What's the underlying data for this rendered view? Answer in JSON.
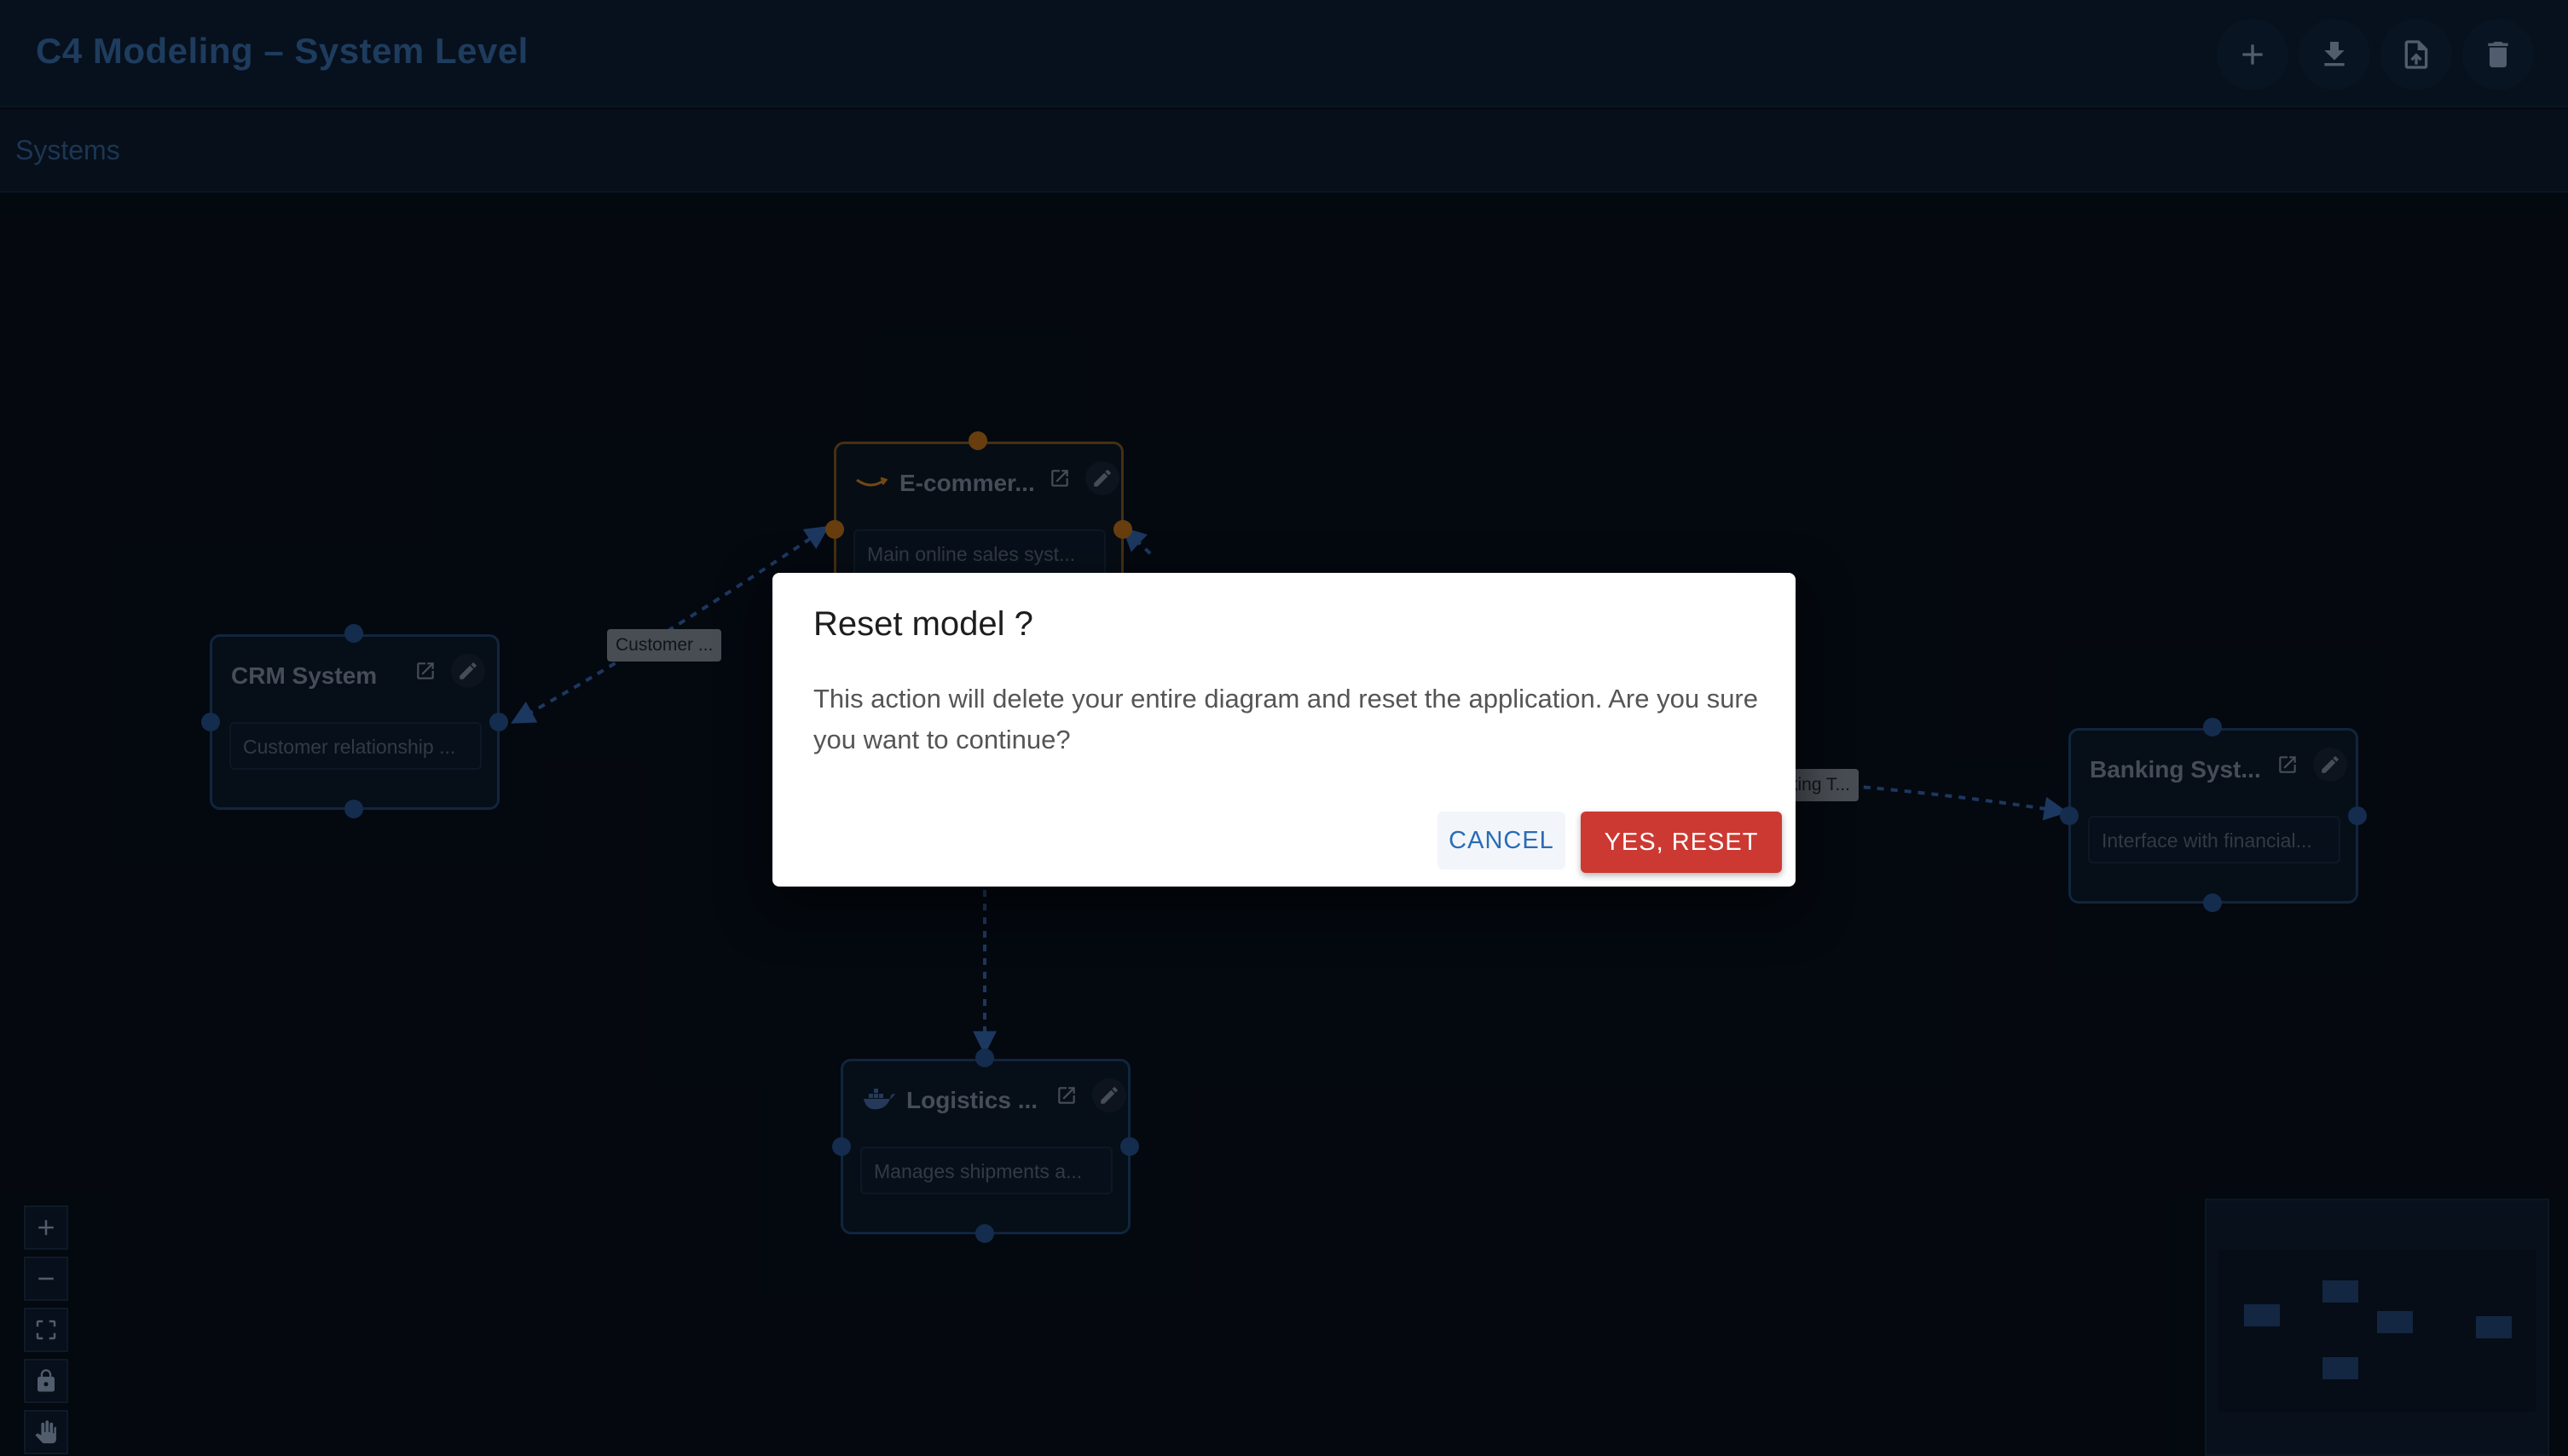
{
  "app": {
    "title": "C4 Modeling – System Level"
  },
  "header": {
    "actions": [
      {
        "name": "add",
        "icon": "plus-icon"
      },
      {
        "name": "download",
        "icon": "download-icon"
      },
      {
        "name": "upload",
        "icon": "file-upload-icon"
      },
      {
        "name": "delete",
        "icon": "trash-icon"
      }
    ]
  },
  "breadcrumb": {
    "label": "Systems"
  },
  "nodes": {
    "crm": {
      "title": "CRM System",
      "description": "Customer relationship ..."
    },
    "ecommerce": {
      "title": "E-commer...",
      "description": "Main online sales syst...",
      "icon": "amazon-smile-icon"
    },
    "banking": {
      "title": "Banking Syst...",
      "description": "Interface with financial..."
    },
    "logistics": {
      "title": "Logistics ...",
      "description": "Manages shipments a...",
      "icon": "docker-whale-icon"
    }
  },
  "edges": {
    "customer_label": "Customer ...",
    "banking_label": "king T..."
  },
  "controls": [
    "zoom-in-icon",
    "zoom-out-icon",
    "fit-view-icon",
    "lock-icon",
    "pan-hand-icon"
  ],
  "dialog": {
    "title": "Reset model ?",
    "text": "This action will delete your entire diagram and reset the application. Are you sure you want to continue?",
    "cancel_label": "CANCEL",
    "confirm_label": "YES, RESET"
  },
  "colors": {
    "background": "#070d17",
    "title": "#2f5c8f",
    "node_border": "#1b3a5e",
    "highlight": "#a06018",
    "danger": "#cc3932",
    "link": "#2b6cb5"
  }
}
